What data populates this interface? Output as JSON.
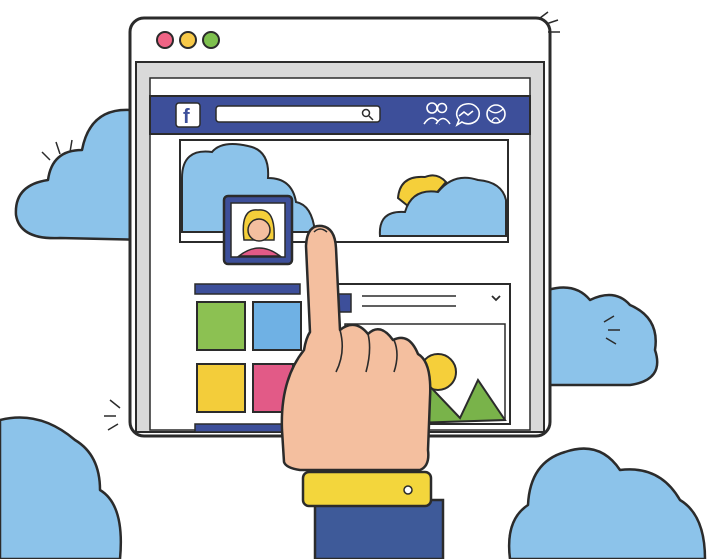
{
  "logo": {
    "letter": "f"
  },
  "colors": {
    "navbar": "#3d4f9a",
    "cloud": "#8cc3ea",
    "sun": "#f5cf3a",
    "skin": "#f4bf9f",
    "sleeve": "#3e5a99",
    "cuff": "#f3d63c",
    "tile_green": "#8cc152",
    "tile_blue": "#6fb1e4",
    "tile_yellow": "#f3cd3a",
    "tile_pink": "#e25a87",
    "mountain": "#79b34a",
    "traffic_red": "#f06485",
    "traffic_yellow": "#f7c948",
    "traffic_green": "#7ec04e"
  },
  "icons": {
    "search": "magnifier-icon",
    "friends": "friends-icon",
    "messenger": "messenger-icon",
    "notifications": "globe-icon"
  }
}
